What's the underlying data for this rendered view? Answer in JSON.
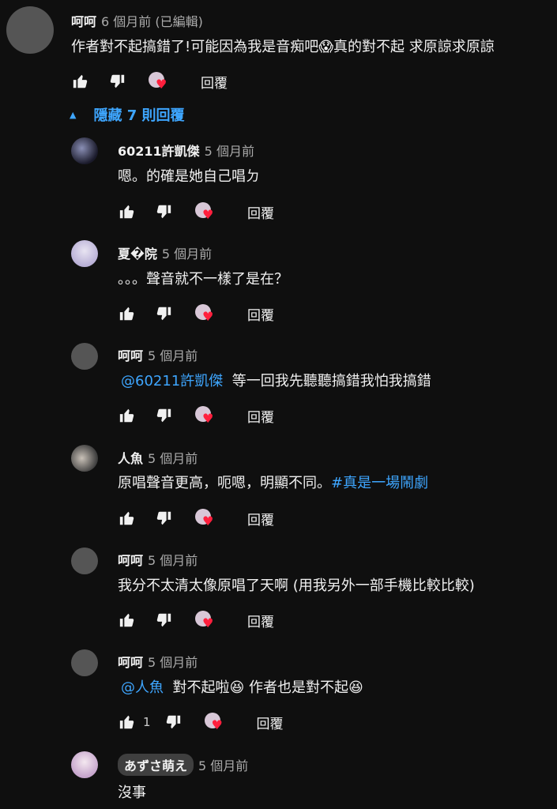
{
  "top_comment": {
    "author": "呵呵",
    "time": "6 個月前 (已編輯)",
    "text": "作者對不起搞錯了!可能因為我是音痴吧😱真的對不起 求原諒求原諒",
    "reply_label": "回覆"
  },
  "hide_replies_label": "隱藏 7 則回覆",
  "replies": [
    {
      "author": "60211許凱傑",
      "time": "5 個月前",
      "text": "嗯。的確是她自己唱ㄉ",
      "reply_label": "回覆",
      "avatar": "avatar-image-dark"
    },
    {
      "author": "夏�院",
      "time": "5 個月前",
      "text": "。。。聲音就不一樣了是在？",
      "reply_label": "回覆",
      "avatar": "avatar-image-anime"
    },
    {
      "author": "呵呵",
      "time": "5 個月前",
      "mention": "@60211許凱傑",
      "text": "等一回我先聽聽搞錯我怕我搞錯",
      "reply_label": "回覆",
      "avatar": "avatar-gray"
    },
    {
      "author": "人魚",
      "time": "5 個月前",
      "text": "原唱聲音更高，呃嗯，明顯不同。",
      "hashtag": "#真是一場鬧劇",
      "reply_label": "回覆",
      "avatar": "avatar-image-photo"
    },
    {
      "author": "呵呵",
      "time": "5 個月前",
      "text": "我分不太清太像原唱了天啊 (用我另外一部手機比較比較)",
      "reply_label": "回覆",
      "avatar": "avatar-gray"
    },
    {
      "author": "呵呵",
      "time": "5 個月前",
      "mention": "@人魚",
      "text": "對不起啦😆 作者也是對不起😆",
      "likes": "1",
      "reply_label": "回覆",
      "avatar": "avatar-gray"
    },
    {
      "author": "あずさ萌え",
      "time": "5 個月前",
      "text": "沒事",
      "avatar": "avatar-image-anime2"
    }
  ],
  "icons": {
    "like": "thumbs-up-icon",
    "dislike": "thumbs-down-icon",
    "creator_heart": "creator-heart-icon",
    "collapse": "caret-up-icon"
  },
  "colors": {
    "background": "#0f0f0f",
    "link": "#3ea6ff",
    "heart": "#ff1f3d"
  }
}
